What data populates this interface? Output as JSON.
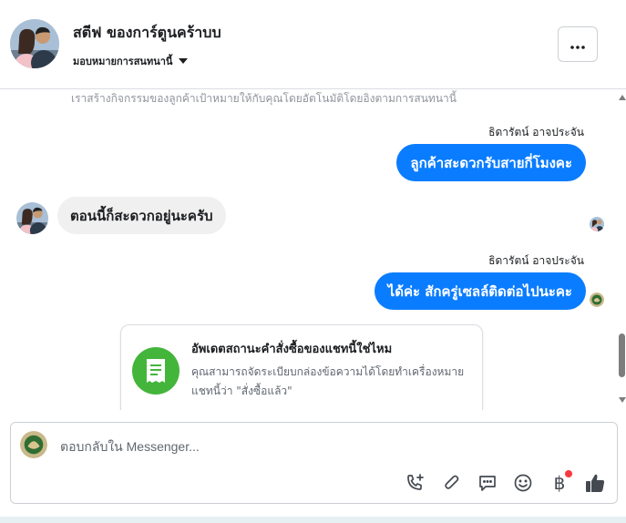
{
  "header": {
    "contact_name": "สตีฟ ของการ์ตูนคร้าบบ",
    "assign_label": "มอบหมายการสนทนานี้",
    "more_label": "•••"
  },
  "thread": {
    "system_note": "เราสร้างกิจกรรมของลูกค้าเป้าหมายให้กับคุณโดยอัตโนมัติโดยอิงตามการสนทนานี้",
    "messages": [
      {
        "sender": "ธิดารัตน์ อาจประจัน",
        "text": "ลูกค้าสะดวกรับสายกี่โมงคะ",
        "direction": "out"
      },
      {
        "text": "ตอนนี้ก็สะดวกอยู่นะครับ",
        "direction": "in"
      },
      {
        "sender": "ธิดารัตน์ อาจประจัน",
        "text": "ได้ค่ะ สักครู่เซลล์ติดต่อไปนะคะ",
        "direction": "out"
      }
    ],
    "order_card": {
      "title": "อัพเดตสถานะคำสั่งซื้อของแชทนี้ใช่ไหม",
      "body": "คุณสามารถจัดระเบียบกล่องข้อความได้โดยทำเครื่องหมายแชทนี้ว่า \"สั่งซื้อแล้ว\"",
      "icon": "receipt-icon"
    }
  },
  "composer": {
    "placeholder": "ตอบกลับใน Messenger...",
    "value": "",
    "toolbar": [
      "phone-add-icon",
      "paperclip-icon",
      "saved-reply-icon",
      "emoji-icon",
      "baht-payment-icon",
      "thumbs-up-icon"
    ],
    "payment_glyph": "฿"
  },
  "colors": {
    "outgoing_bubble": "#0a7cff",
    "incoming_bubble": "#f0f0f0",
    "accent_green": "#44b53b",
    "like_button": "#444950",
    "notification_dot": "#fa383e"
  }
}
